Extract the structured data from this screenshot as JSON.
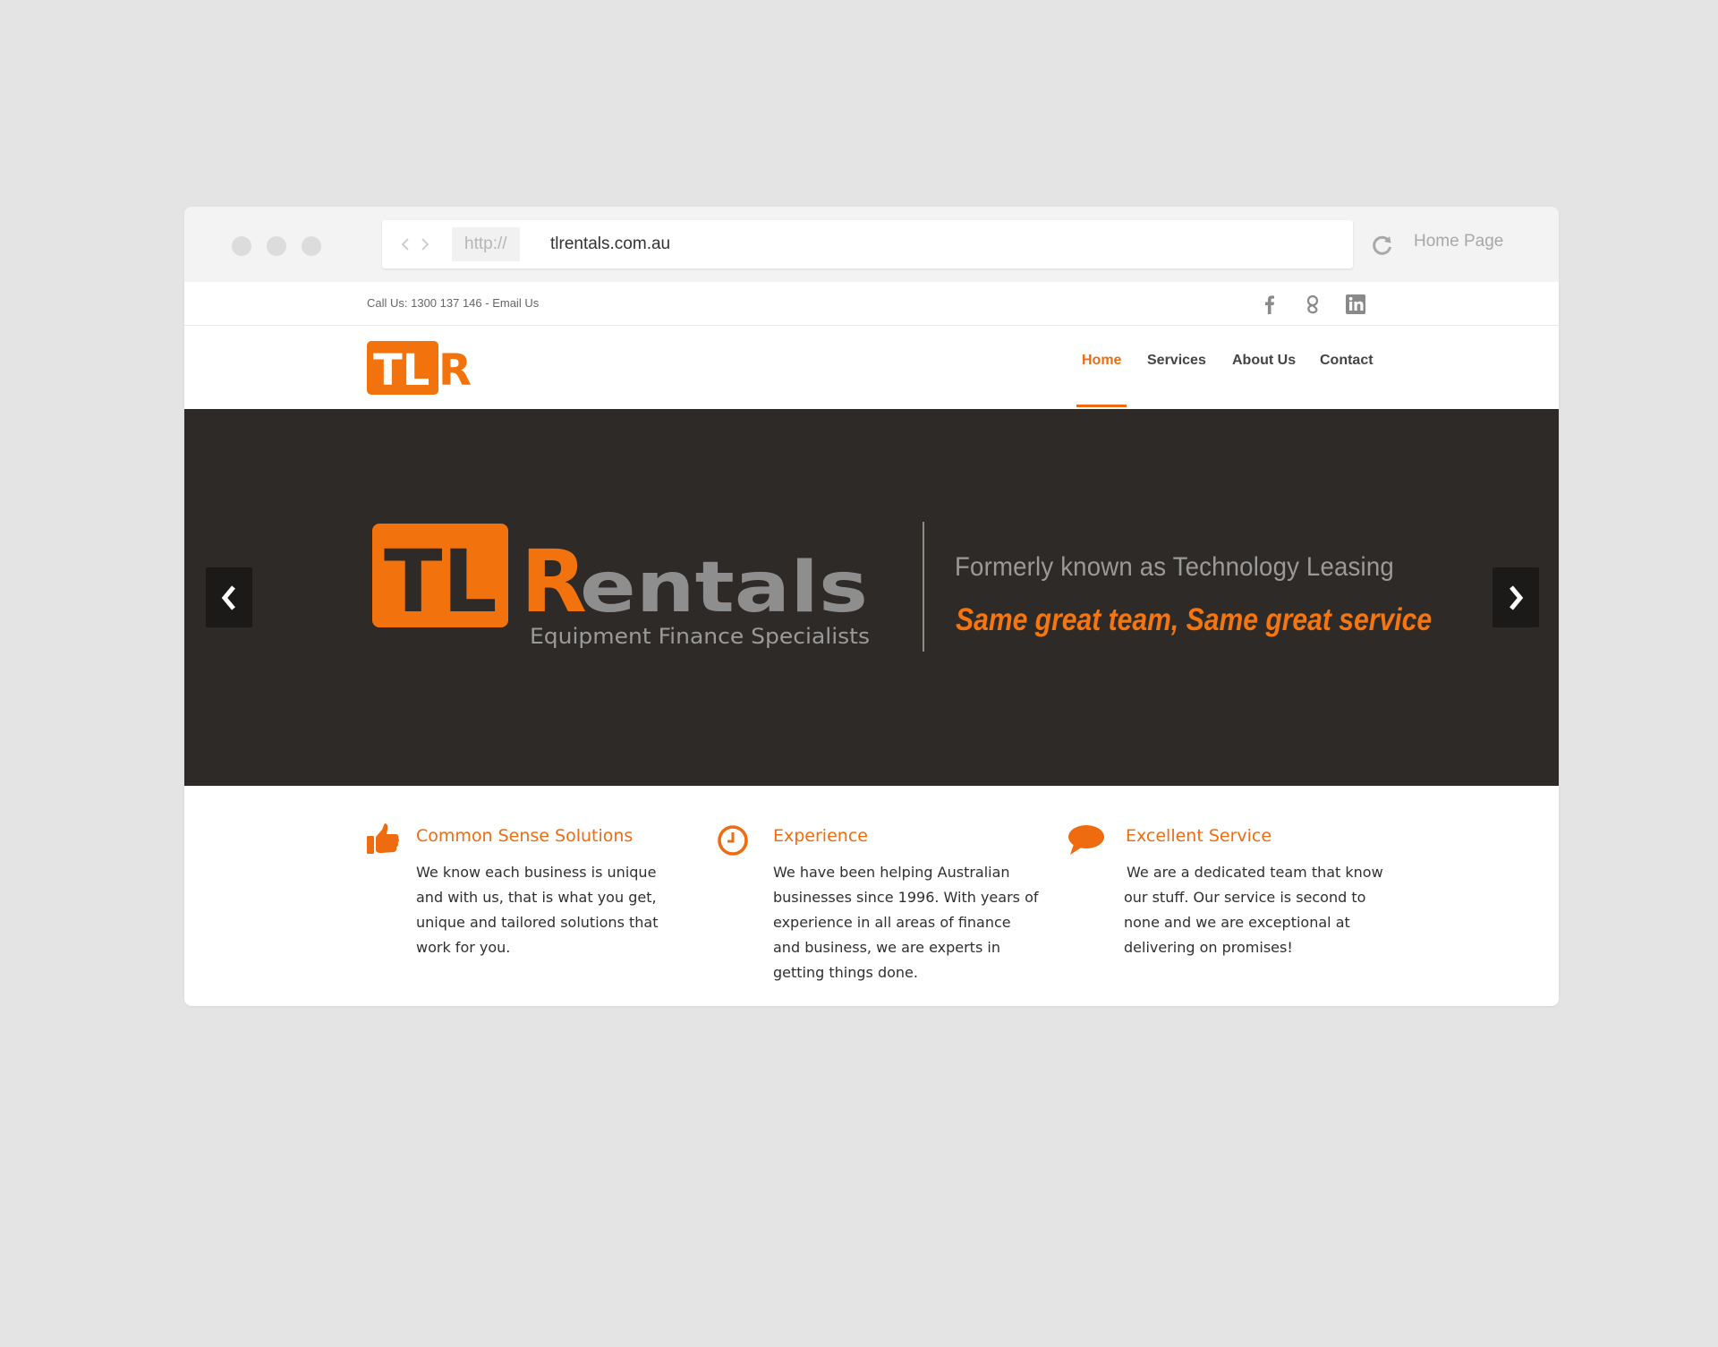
{
  "browser": {
    "protocol": "http://",
    "url": "tlrentals.com.au",
    "home_label": "Home Page"
  },
  "topbar": {
    "contact_text": "Call Us: 1300 137 146 - Email Us",
    "social": [
      "facebook-icon",
      "google-plus-icon",
      "linkedin-icon"
    ]
  },
  "header": {
    "logo_text": "TLR",
    "nav": [
      {
        "label": "Home",
        "active": true
      },
      {
        "label": "Services",
        "active": false
      },
      {
        "label": "About Us",
        "active": false
      },
      {
        "label": "Contact",
        "active": false
      }
    ]
  },
  "hero": {
    "logo_tl": "TL",
    "logo_r": "R",
    "logo_entals": "entals",
    "logo_subtitle": "Equipment Finance Specialists",
    "formerly": "Formerly known as Technology Leasing",
    "tagline": "Same great team, Same great service"
  },
  "features": [
    {
      "icon": "thumbs-up-icon",
      "title": "Common Sense Solutions",
      "body": "We know each business is unique and with us, that is what you get, unique and tailored solutions that work for you."
    },
    {
      "icon": "clock-icon",
      "title": "Experience",
      "body": "We have been helping Australian businesses since 1996. With years of experience in all areas of finance and business, we are experts in getting things done."
    },
    {
      "icon": "speech-bubble-icon",
      "title": "Excellent Service",
      "body": "We are a dedicated team that know our stuff. Our service is second to none and we are exceptional at delivering on promises!"
    }
  ],
  "colors": {
    "accent": "#ee6c0f",
    "hero_bg": "#2d2a27",
    "page_bg": "#e4e4e4"
  }
}
